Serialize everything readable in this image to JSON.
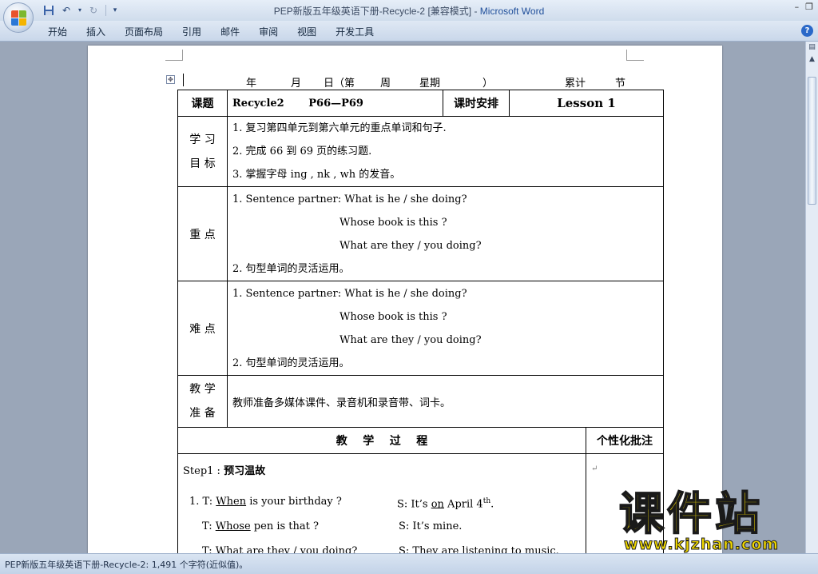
{
  "window": {
    "title_doc": "PEP新版五年级英语下册-Recycle-2 [兼容模式] - ",
    "title_app": "Microsoft Word",
    "controls": {
      "minimize": "–",
      "restore": "❐"
    }
  },
  "ribbon": {
    "tabs": [
      "开始",
      "插入",
      "页面布局",
      "引用",
      "邮件",
      "审阅",
      "视图",
      "开发工具"
    ]
  },
  "status": {
    "text": "PEP新版五年级英语下册-Recycle-2: 1,491 个字符(近似值)。"
  },
  "doc": {
    "dateline": [
      "年",
      "月",
      "日（第",
      "周",
      "星期",
      "）",
      "累计",
      "节"
    ],
    "topic_label": "课题",
    "topic_value": "Recycle2",
    "pages": "P66—P69",
    "schedule_label": "课时安排",
    "lesson": "Lesson 1",
    "goals_label": [
      "学 习",
      "目 标"
    ],
    "goals": [
      "1. 复习第四单元到第六单元的重点单词和句子.",
      "2. 完成 66 到 69 页的练习题.",
      "3. 掌握字母 ing , nk , wh 的发音。"
    ],
    "key_label": "重 点",
    "key_lines": [
      "1.   Sentence partner: What is he / she doing?",
      "Whose book is this ?",
      "What are they / you doing?",
      "2. 句型单词的灵活运用。"
    ],
    "diff_label": "难 点",
    "diff_lines": [
      "1. Sentence partner: What is he / she doing?",
      "Whose book is this ?",
      "What are they / you doing?",
      "2. 句型单词的灵活运用。"
    ],
    "prep_label": [
      "教 学",
      "准 备"
    ],
    "prep_text": "教师准备多媒体课件、录音机和录音带、词卡。",
    "process_label": "教    学    过    程",
    "note_label": "个性化批注",
    "step1_prefix": "Step1 : ",
    "step1_title": "预习温故",
    "dialog": [
      {
        "t_pre": "1. T: ",
        "t_u": "When",
        "t_post": " is your birthday ?",
        "s_pre": "S: It’s ",
        "s_u": "on",
        "s_post": " April 4",
        "s_sup": "th",
        "s_end": "."
      },
      {
        "t_pre": "T: ",
        "t_u": "Whose",
        "t_post": " pen is that ?",
        "s_pre": "S: It’s mine.",
        "s_u": "",
        "s_post": "",
        "s_sup": "",
        "s_end": ""
      },
      {
        "t_pre": "T: ",
        "t_u": "What",
        "t_post": " are they / you doing?",
        "s_pre": "S: They are listening to music.",
        "s_u": "",
        "s_post": "",
        "s_sup": "",
        "s_end": ""
      }
    ]
  },
  "watermark": {
    "cn": "课件站",
    "url": "www.kjzhan.com"
  }
}
